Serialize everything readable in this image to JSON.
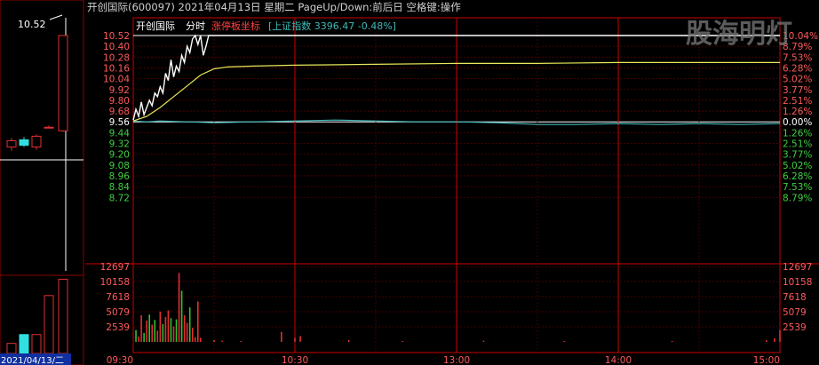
{
  "header": {
    "text": "开创国际(600097)  2021年04月13日 星期二 PageUp/Down:前后日 空格键:操作"
  },
  "chart_title": {
    "stock_name": "开创国际",
    "mode_label": "分时",
    "limit_coord_label": "涨停板坐标",
    "index_text": "[上证指数 3396.47 -0.48%]"
  },
  "watermark": {
    "text": "股海明灯"
  },
  "left_panel": {
    "price_label": "10.52",
    "date_label": "2021/04/13/二"
  },
  "colors": {
    "background": "#000000",
    "axis_red": "#cc0000",
    "grid_red": "#5a0000",
    "price_line": "#ffffff",
    "avg_line": "#e8e85a",
    "index_line": "#3fb8b8",
    "volume_up": "#e03030",
    "volume_down": "#30c030",
    "label_red": "#ff5a5a",
    "label_green": "#40d040",
    "label_white": "#ffffff",
    "header_text": "#d0d0d0",
    "watermark": "#7a7a7a"
  },
  "chart_data": {
    "type": "line",
    "x_ticks": [
      "09:30",
      "10:30",
      "13:00",
      "14:00",
      "15:00"
    ],
    "price_ticks_left": [
      "10.52",
      "10.40",
      "10.28",
      "10.16",
      "10.04",
      "9.92",
      "9.80",
      "9.68",
      "9.56",
      "9.44",
      "9.32",
      "9.20",
      "9.08",
      "8.96",
      "8.84",
      "8.72"
    ],
    "pct_ticks_right": [
      "10.04%",
      "8.79%",
      "7.53%",
      "6.28%",
      "5.02%",
      "3.77%",
      "2.51%",
      "1.26%",
      "0.00%",
      "1.26%",
      "2.51%",
      "3.77%",
      "5.02%",
      "6.28%",
      "7.53%",
      "8.79%"
    ],
    "volume_ticks": [
      "12697",
      "10158",
      "7618",
      "5079",
      "2539"
    ],
    "ylim": [
      8.6,
      10.52
    ],
    "prev_close": 9.56,
    "price_series": {
      "name": "",
      "points": [
        [
          0,
          9.58
        ],
        [
          1,
          9.7
        ],
        [
          2,
          9.62
        ],
        [
          3,
          9.78
        ],
        [
          4,
          9.64
        ],
        [
          5,
          9.72
        ],
        [
          6,
          9.8
        ],
        [
          7,
          9.74
        ],
        [
          8,
          9.88
        ],
        [
          9,
          9.84
        ],
        [
          10,
          9.95
        ],
        [
          11,
          9.88
        ],
        [
          12,
          10.1
        ],
        [
          13,
          10.02
        ],
        [
          14,
          10.25
        ],
        [
          15,
          10.06
        ],
        [
          16,
          10.18
        ],
        [
          17,
          10.12
        ],
        [
          18,
          10.3
        ],
        [
          19,
          10.22
        ],
        [
          20,
          10.4
        ],
        [
          21,
          10.33
        ],
        [
          22,
          10.48
        ],
        [
          23,
          10.52
        ],
        [
          24,
          10.42
        ],
        [
          25,
          10.52
        ],
        [
          26,
          10.3
        ],
        [
          27,
          10.4
        ],
        [
          28,
          10.52
        ],
        [
          29,
          10.52
        ],
        [
          240,
          10.52
        ]
      ]
    },
    "avg_series": {
      "name": "",
      "points": [
        [
          0,
          9.57
        ],
        [
          5,
          9.62
        ],
        [
          10,
          9.72
        ],
        [
          15,
          9.84
        ],
        [
          20,
          9.96
        ],
        [
          25,
          10.08
        ],
        [
          30,
          10.15
        ],
        [
          35,
          10.17
        ],
        [
          45,
          10.18
        ],
        [
          60,
          10.19
        ],
        [
          90,
          10.2
        ],
        [
          120,
          10.21
        ],
        [
          150,
          10.21
        ],
        [
          180,
          10.22
        ],
        [
          210,
          10.22
        ],
        [
          240,
          10.22
        ]
      ]
    },
    "index_series": {
      "name": "",
      "points": [
        [
          0,
          9.57
        ],
        [
          5,
          9.56
        ],
        [
          10,
          9.57
        ],
        [
          20,
          9.56
        ],
        [
          30,
          9.55
        ],
        [
          45,
          9.56
        ],
        [
          60,
          9.57
        ],
        [
          75,
          9.58
        ],
        [
          90,
          9.57
        ],
        [
          105,
          9.56
        ],
        [
          120,
          9.56
        ],
        [
          135,
          9.55
        ],
        [
          150,
          9.53
        ],
        [
          165,
          9.53
        ],
        [
          180,
          9.54
        ],
        [
          195,
          9.53
        ],
        [
          210,
          9.54
        ],
        [
          225,
          9.53
        ],
        [
          240,
          9.54
        ]
      ]
    },
    "volume_ylim": [
      0,
      12697
    ],
    "volume": [
      [
        1,
        2000,
        "down"
      ],
      [
        2,
        900,
        "up"
      ],
      [
        3,
        4500,
        "up"
      ],
      [
        4,
        1500,
        "down"
      ],
      [
        5,
        3600,
        "up"
      ],
      [
        6,
        4600,
        "down"
      ],
      [
        7,
        2900,
        "up"
      ],
      [
        8,
        3700,
        "down"
      ],
      [
        9,
        1900,
        "up"
      ],
      [
        10,
        5100,
        "up"
      ],
      [
        11,
        3000,
        "down"
      ],
      [
        12,
        4200,
        "up"
      ],
      [
        13,
        5300,
        "up"
      ],
      [
        14,
        4000,
        "down"
      ],
      [
        15,
        2600,
        "up"
      ],
      [
        16,
        3800,
        "down"
      ],
      [
        17,
        11600,
        "up"
      ],
      [
        18,
        8600,
        "down"
      ],
      [
        19,
        4500,
        "up"
      ],
      [
        20,
        3200,
        "up"
      ],
      [
        21,
        5800,
        "down"
      ],
      [
        22,
        2400,
        "up"
      ],
      [
        23,
        800,
        "up"
      ],
      [
        24,
        6800,
        "up"
      ],
      [
        25,
        700,
        "up"
      ],
      [
        30,
        300,
        "up"
      ],
      [
        33,
        200,
        "up"
      ],
      [
        40,
        150,
        "up"
      ],
      [
        55,
        1700,
        "up"
      ],
      [
        60,
        700,
        "up"
      ],
      [
        62,
        1000,
        "up"
      ],
      [
        80,
        300,
        "up"
      ],
      [
        100,
        150,
        "up"
      ],
      [
        130,
        200,
        "up"
      ],
      [
        160,
        150,
        "up"
      ],
      [
        200,
        150,
        "up"
      ],
      [
        235,
        300,
        "up"
      ],
      [
        238,
        600,
        "up"
      ],
      [
        240,
        2000,
        "up"
      ]
    ],
    "left_candles": [
      {
        "open": 9.35,
        "close": 9.28,
        "high": 9.38,
        "low": 9.24,
        "color": "red"
      },
      {
        "open": 9.3,
        "close": 9.36,
        "high": 9.39,
        "low": 9.28,
        "color": "cyan"
      },
      {
        "open": 9.4,
        "close": 9.28,
        "high": 9.42,
        "low": 9.25,
        "color": "red"
      },
      {
        "open": 9.5,
        "close": 9.5,
        "high": 9.52,
        "low": 9.49,
        "color": "red"
      },
      {
        "open": 9.46,
        "close": 10.52,
        "high": 10.52,
        "low": 9.45,
        "color": "red"
      }
    ],
    "left_volume": [
      {
        "value": 800,
        "color": "red"
      },
      {
        "value": 1500,
        "color": "cyan"
      },
      {
        "value": 1500,
        "color": "red"
      },
      {
        "value": 4600,
        "color": "red"
      },
      {
        "value": 5900,
        "color": "red"
      }
    ]
  }
}
